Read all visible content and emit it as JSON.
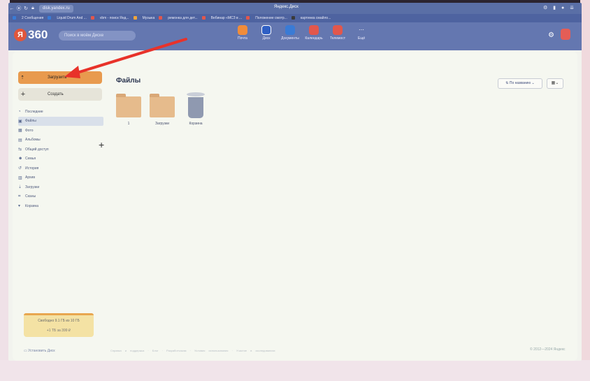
{
  "browser": {
    "url": "disk.yandex.ru",
    "tab_title": "Яндекс.Диск",
    "bookmarks": [
      "2 Сообщения",
      "Liquid Drum And ...",
      "vbm - поиск Янд...",
      "Музыка",
      "ремонка для дет...",
      "Вебинар «МСЗ в ...",
      "Положение смотр...",
      "картинка смайло..."
    ]
  },
  "header": {
    "logo_text": "360",
    "logo_badge": "Я",
    "search_placeholder": "Поиск в моём Диске",
    "services": [
      {
        "label": "Почта",
        "color": "#f08c3a"
      },
      {
        "label": "Диск",
        "color": "#2f5fc4"
      },
      {
        "label": "Документы",
        "color": "#3a7bd5"
      },
      {
        "label": "Календарь",
        "color": "#e2574c"
      },
      {
        "label": "Телемост",
        "color": "#e2574c"
      },
      {
        "label": "Ещё",
        "color": "transparent"
      }
    ]
  },
  "sidebar": {
    "upload_label": "Загрузить",
    "create_label": "Создать",
    "items": [
      {
        "label": "Последние",
        "icon": "clock-icon"
      },
      {
        "label": "Файлы",
        "icon": "folder-icon",
        "active": true
      },
      {
        "label": "Фото",
        "icon": "photo-icon"
      },
      {
        "label": "Альбомы",
        "icon": "album-icon"
      },
      {
        "label": "Общий доступ",
        "icon": "share-icon"
      },
      {
        "label": "Семья",
        "icon": "family-icon"
      },
      {
        "label": "История",
        "icon": "history-icon"
      },
      {
        "label": "Архив",
        "icon": "archive-icon"
      },
      {
        "label": "Загрузки",
        "icon": "download-icon"
      },
      {
        "label": "Сканы",
        "icon": "scan-icon"
      },
      {
        "label": "Корзина",
        "icon": "trash-icon"
      }
    ],
    "storage_text": "Свободно 9.1 ГБ из 10 ГБ",
    "storage_offer": "+1 ТБ за 399 ₽",
    "install_label": "Установить Диск"
  },
  "main": {
    "title": "Файлы",
    "sort_label": "По названию",
    "files": [
      {
        "name": "1",
        "type": "folder"
      },
      {
        "name": "Загрузки",
        "type": "folder"
      },
      {
        "name": "Корзина",
        "type": "trash"
      }
    ]
  },
  "footer": {
    "links": "Справка и поддержка · Блог · Разработчикам · Условия использования · Участие в исследованиях",
    "right_text": "© 2012—2024 Яндекс"
  },
  "annotation_color": "#e8322a"
}
